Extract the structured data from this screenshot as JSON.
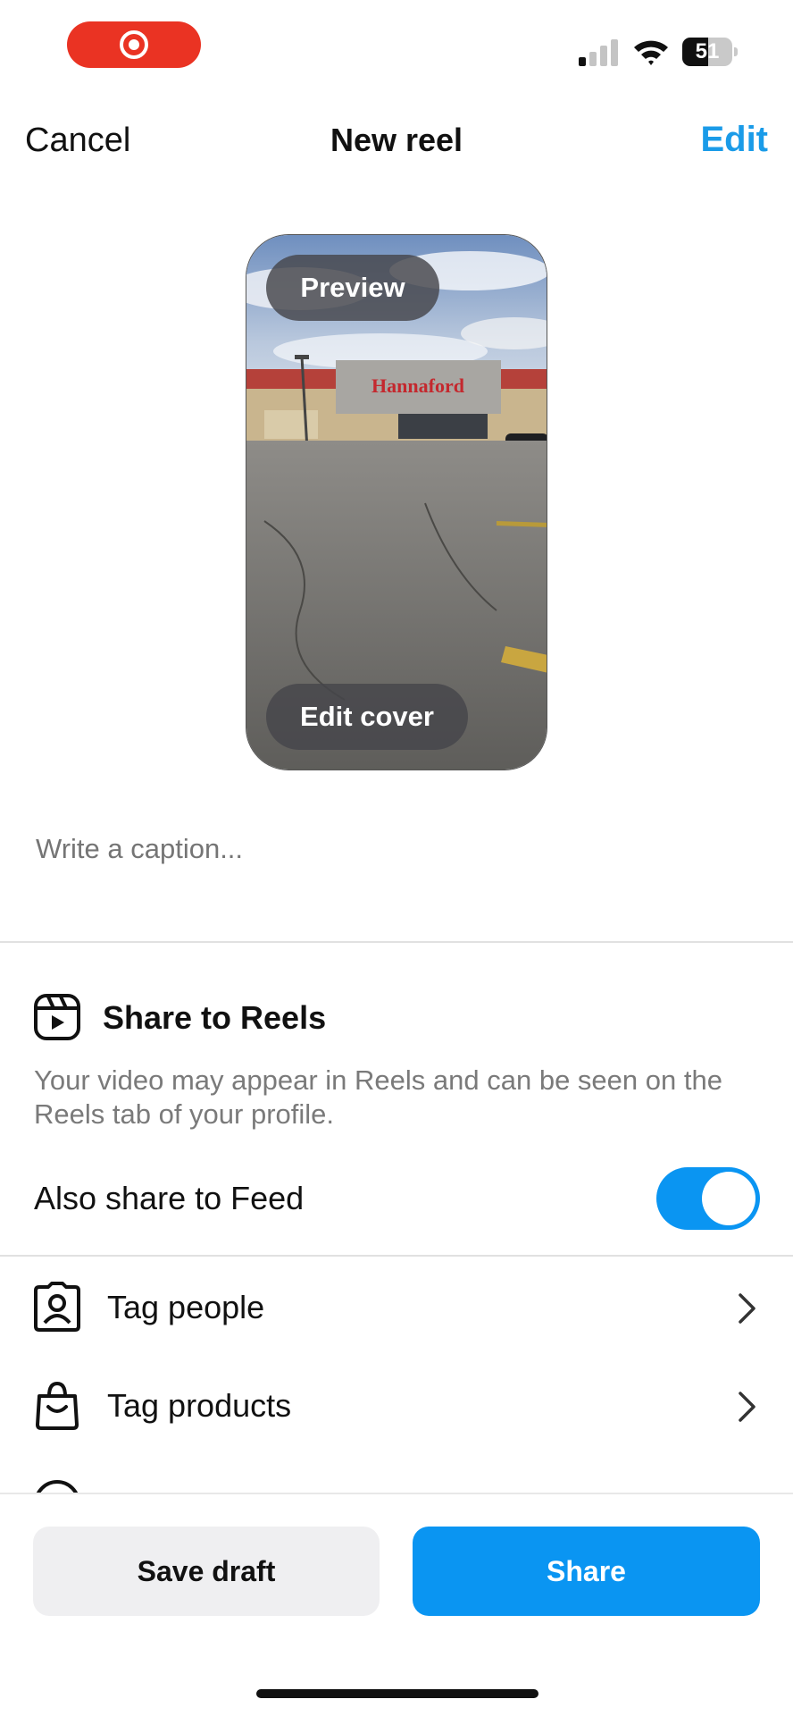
{
  "status_bar": {
    "battery": "51",
    "battery_level": 0.51,
    "recording_color": "#ea3323"
  },
  "header": {
    "cancel_label": "Cancel",
    "title": "New reel",
    "edit_label": "Edit",
    "accent_color": "#1a9be8"
  },
  "preview": {
    "preview_label": "Preview",
    "edit_cover_label": "Edit cover",
    "store_sign": "Hannaford"
  },
  "caption": {
    "placeholder": "Write a caption..."
  },
  "reels": {
    "icon": "reels-icon",
    "title": "Share to Reels",
    "description": "Your video may appear in Reels and can be seen on the Reels tab of your profile.",
    "feed_label": "Also share to Feed",
    "feed_enabled": true,
    "toggle_color": "#0a95f2"
  },
  "rows": [
    {
      "icon": "tag-people-icon",
      "label": "Tag people"
    },
    {
      "icon": "tag-products-icon",
      "label": "Tag products"
    }
  ],
  "bottom": {
    "save_draft_label": "Save draft",
    "share_label": "Share",
    "share_color": "#0a95f2"
  }
}
